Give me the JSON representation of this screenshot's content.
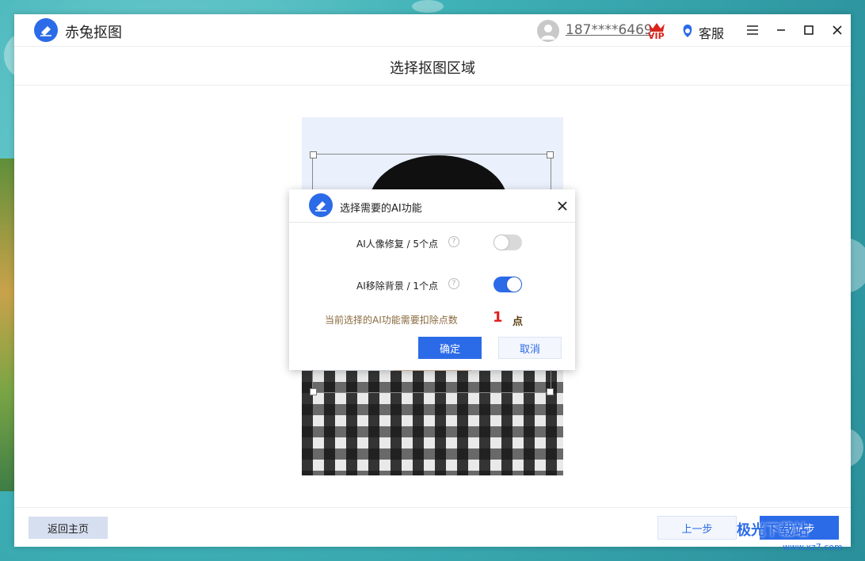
{
  "app": {
    "title": "赤兔抠图"
  },
  "header": {
    "phone": "187****6469",
    "vip_label": "VIP",
    "service_label": "客服"
  },
  "page": {
    "title": "选择抠图区域"
  },
  "dialog": {
    "title": "选择需要的AI功能",
    "options": [
      {
        "label": "AI人像修复 / 5个点",
        "enabled": false
      },
      {
        "label": "AI移除背景 / 1个点",
        "enabled": true
      }
    ],
    "help_glyph": "?",
    "summary_text": "当前选择的AI功能需要扣除点数",
    "count": "1",
    "count_unit": "点",
    "confirm_label": "确定",
    "cancel_label": "取消"
  },
  "footer": {
    "home_label": "返回主页",
    "prev_label": "上一步",
    "next_label": "下一步"
  },
  "watermark": {
    "text": "极光下载站",
    "url": "www.xz7.com"
  },
  "colors": {
    "accent": "#2c6be8",
    "toggle_off": "#d9d9d9",
    "count_red": "#e02020"
  }
}
